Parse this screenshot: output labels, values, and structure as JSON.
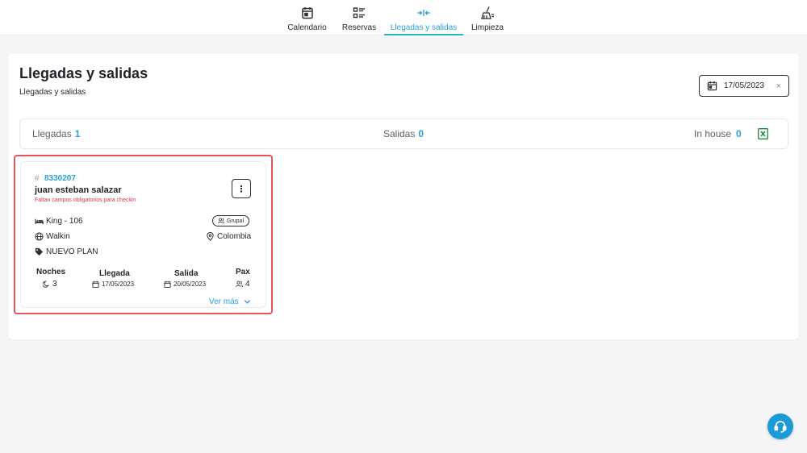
{
  "nav": {
    "items": [
      {
        "label": "Calendario",
        "icon": "calendar-icon"
      },
      {
        "label": "Reservas",
        "icon": "list-icon"
      },
      {
        "label": "Llegadas y salidas",
        "icon": "arrows-in-out-icon"
      },
      {
        "label": "Limpieza",
        "icon": "broom-icon"
      }
    ],
    "active": "Llegadas y salidas"
  },
  "page": {
    "title": "Llegadas y salidas",
    "subtitle": "Llegadas y salidas"
  },
  "date_filter": {
    "value": "17/05/2023",
    "clear": "×"
  },
  "summary": {
    "llegadas_label": "Llegadas",
    "llegadas_count": "1",
    "salidas_label": "Salidas",
    "salidas_count": "0",
    "inhouse_label": "In house",
    "inhouse_count": "0"
  },
  "booking": {
    "hash": "#",
    "number": "8330207",
    "guest": "juan esteban salazar",
    "warning": "Faltan campos obligatorios para checkin",
    "room": "King - 106",
    "badge": "Grupal",
    "channel": "Walkin",
    "country": "Colombia",
    "plan": "NUEVO PLAN",
    "menu": "⋮",
    "stats": {
      "noches_label": "Noches",
      "noches_value": "3",
      "llegada_label": "Llegada",
      "llegada_value": "17/05/2023",
      "salida_label": "Salida",
      "salida_value": "20/05/2023",
      "pax_label": "Pax",
      "pax_value": "4"
    },
    "ver_mas": "Ver más"
  },
  "colors": {
    "accent": "#2b9fd6",
    "active_tab": "#2bb3c9",
    "warning": "#d8394a",
    "highlight": "#e15759",
    "excel": "#1d8a3e",
    "fab": "#1d9bd7"
  }
}
